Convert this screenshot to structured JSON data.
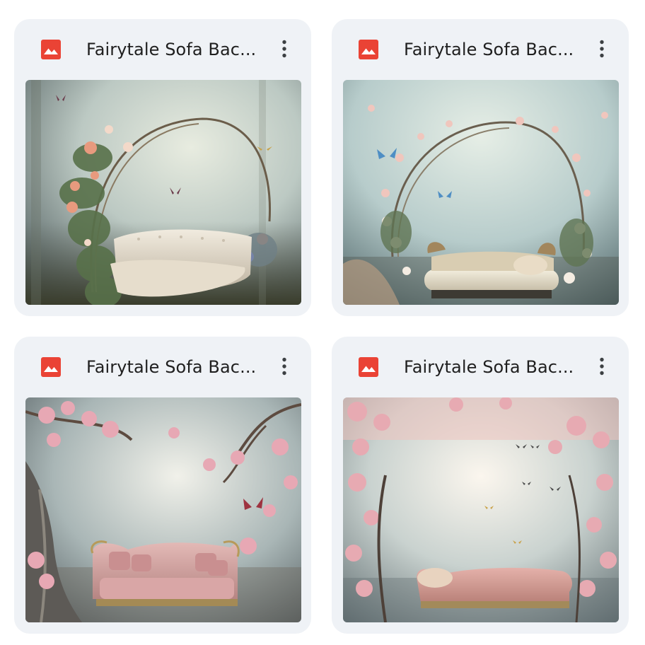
{
  "files": [
    {
      "title": "Fairytale Sofa Bac...",
      "file_icon": "image-icon",
      "menu_icon": "more-vert-icon",
      "thumbnail": "fairytale-sofa-floral-arch-white-sofa"
    },
    {
      "title": "Fairytale Sofa Bac...",
      "file_icon": "image-icon",
      "menu_icon": "more-vert-icon",
      "thumbnail": "fairytale-sofa-floral-arch-bench"
    },
    {
      "title": "Fairytale Sofa Bac...",
      "file_icon": "image-icon",
      "menu_icon": "more-vert-icon",
      "thumbnail": "fairytale-sofa-pink-blossoms-pink-sofa"
    },
    {
      "title": "Fairytale Sofa Bac...",
      "file_icon": "image-icon",
      "menu_icon": "more-vert-icon",
      "thumbnail": "fairytale-sofa-pink-blossoms-chaise"
    }
  ],
  "colors": {
    "card_bg": "#eff2f6",
    "image_icon_red": "#ea4335",
    "title_text": "#1f1f1f",
    "menu_dots": "#3c4043"
  }
}
